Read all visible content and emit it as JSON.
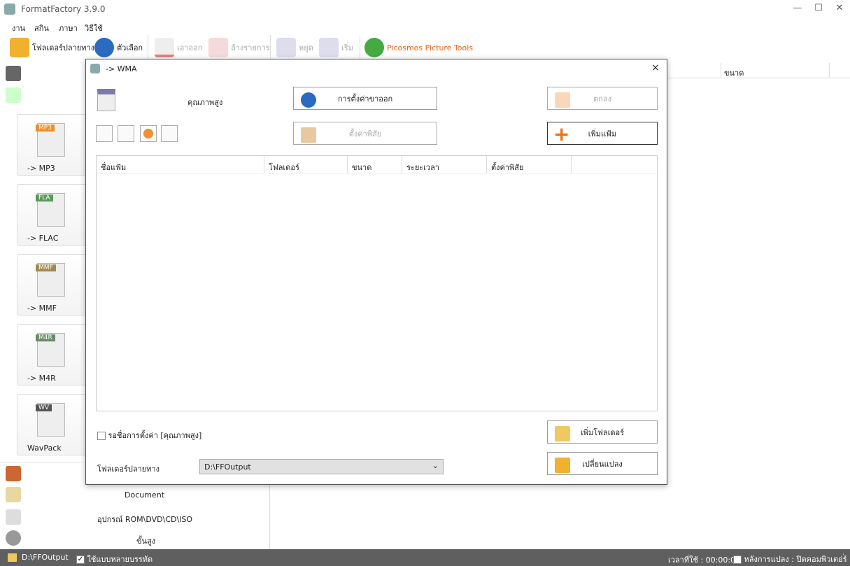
{
  "app": {
    "title": "FormatFactory 3.9.0"
  },
  "menu": [
    "งาน",
    "สกิน",
    "ภาษา",
    "วิธีใช้"
  ],
  "toolbar": {
    "output_folder": "โฟลเดอร์ปลายทาง",
    "options": "ตัวเลือก",
    "remove": "เอาออก",
    "clear_list": "ล้างรายการ",
    "stop": "หยุด",
    "start": "เริ่ม",
    "picosmos": "Picosmos Picture Tools"
  },
  "left": {
    "cards": [
      {
        "label": "-> MP3",
        "tag": "MP3",
        "color": "#e8902a"
      },
      {
        "label": "-> FLAC",
        "tag": "FLA",
        "color": "#5a9a5a"
      },
      {
        "label": "-> MMF",
        "tag": "MMF",
        "color": "#a08a50"
      },
      {
        "label": "-> M4R",
        "tag": "M4R",
        "color": "#6a8a6a"
      },
      {
        "label": "WavPack",
        "tag": "WV",
        "color": "#555555"
      }
    ],
    "categories": {
      "document": "Document",
      "rom": "อุปกรณ์ ROM\\DVD\\CD\\ISO",
      "advanced": "ขั้นสูง"
    }
  },
  "right": {
    "size_header": "ขนาด"
  },
  "dialog": {
    "title": "-> WMA",
    "close": "×",
    "quality": "คุณภาพสูง",
    "output_settings": "การตั้งค่าขาออก",
    "ok": "ตกลง",
    "clip": "ตั้งค่าพิสัย",
    "add_file": "เพิ่มแฟ้ม",
    "columns": [
      "ชื่อแฟ้ม",
      "โฟลเดอร์",
      "ขนาด",
      "ระยะเวลา",
      "ตั้งค่าพิสัย"
    ],
    "wait_label": "รอชื่อการตั้งค่า [คุณภาพสูง]",
    "add_folder": "เพิ่มโฟลเดอร์",
    "dest_label": "โฟลเดอร์ปลายทาง",
    "dest_value": "D:\\FFOutput",
    "convert": "เปลี่ยนแปลง"
  },
  "status": {
    "folder": "D:\\FFOutput",
    "multithread": "ใช้แบบหลายบรรทัด",
    "elapsed": "เวลาที่ใช้ : 00:00:00",
    "after": "หลังการแปลง : ปิดคอมพิวเตอร์"
  }
}
